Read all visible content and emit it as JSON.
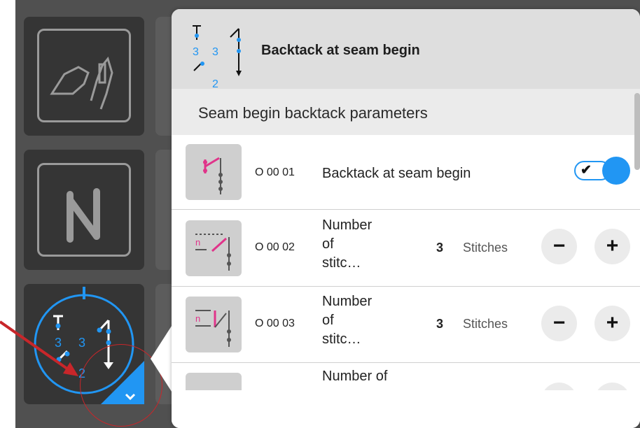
{
  "panel": {
    "header_title": "Backtack at seam begin",
    "section_title": "Seam begin backtack parameters"
  },
  "header_icon": {
    "top_left": "T",
    "num_a": "3",
    "num_b": "3",
    "num_bottom": "2"
  },
  "tile_icon": {
    "top_left": "T",
    "num_a": "3",
    "num_b": "3",
    "num_bottom": "2"
  },
  "rows": [
    {
      "code": "O 00 01",
      "label": "Backtack at seam begin",
      "toggle_state": "on",
      "check": "✔"
    },
    {
      "code": "O 00 02",
      "label_l1": "Number",
      "label_l2": "of",
      "label_l3": "stitc…",
      "value": "3",
      "unit": "Stitches",
      "minus": "−",
      "plus": "+"
    },
    {
      "code": "O 00 03",
      "label_l1": "Number",
      "label_l2": "of",
      "label_l3": "stitc…",
      "value": "3",
      "unit": "Stitches",
      "minus": "−",
      "plus": "+"
    },
    {
      "label_l1": "Number of"
    }
  ],
  "colors": {
    "accent_blue": "#2196f3",
    "icon_magenta": "#e0348a",
    "annotation_red": "#c8262a"
  }
}
